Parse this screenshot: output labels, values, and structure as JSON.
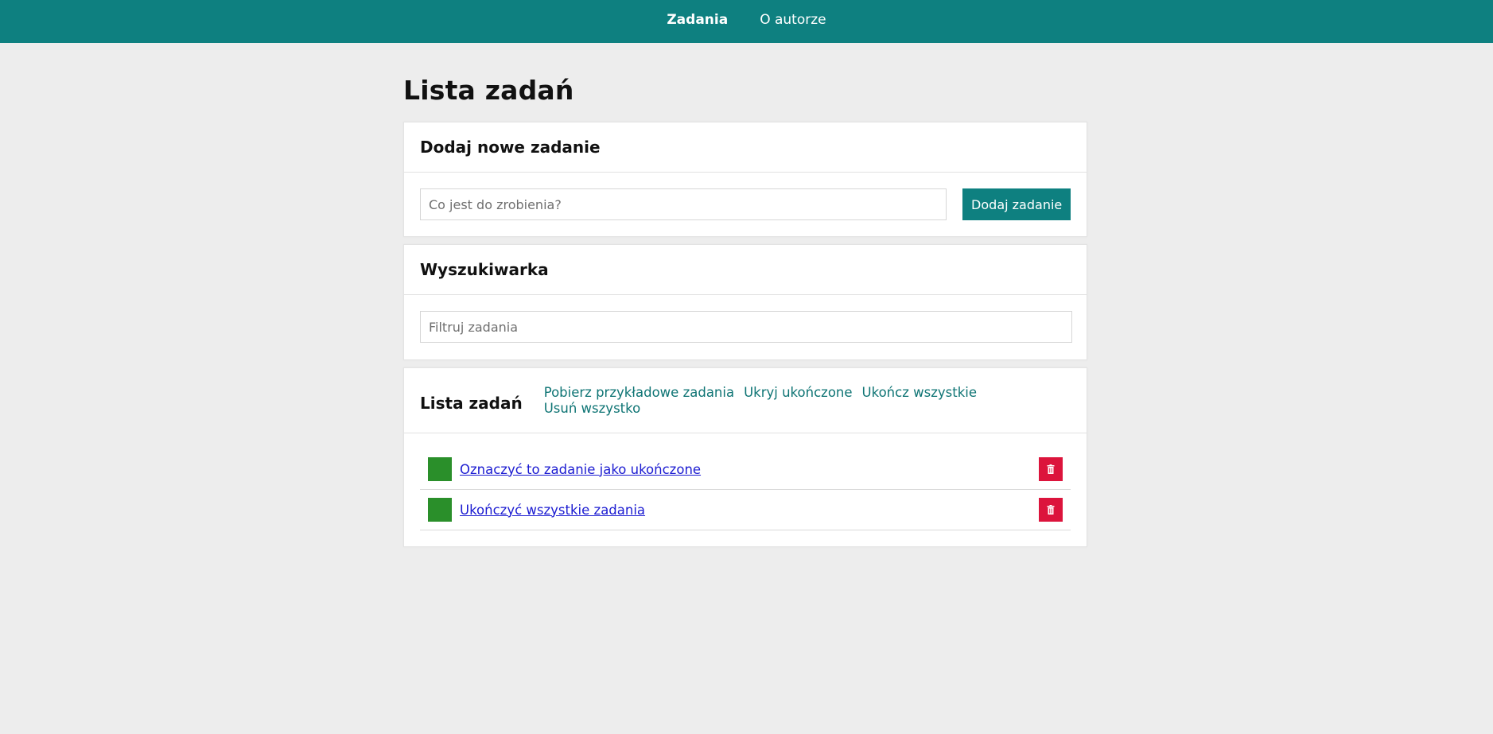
{
  "nav": {
    "items": [
      {
        "label": "Zadania",
        "active": true
      },
      {
        "label": "O autorze",
        "active": false
      }
    ]
  },
  "page": {
    "title": "Lista zadań"
  },
  "add_card": {
    "title": "Dodaj nowe zadanie",
    "input_placeholder": "Co jest do zrobienia?",
    "input_value": "",
    "button_label": "Dodaj zadanie"
  },
  "search_card": {
    "title": "Wyszukiwarka",
    "input_placeholder": "Filtruj zadania",
    "input_value": ""
  },
  "list_card": {
    "title": "Lista zadań",
    "actions": [
      "Pobierz przykładowe zadania",
      "Ukryj ukończone",
      "Ukończ wszystkie",
      "Usuń wszystko"
    ],
    "tasks": [
      {
        "text": "Oznaczyć to zadanie jako ukończone"
      },
      {
        "text": "Ukończyć wszystkie zadania"
      }
    ],
    "delete_icon": "trash-icon"
  },
  "colors": {
    "primary": "#0e8080",
    "check": "#2a8f2a",
    "delete": "#dc143c",
    "link": "#1b1bd1"
  }
}
